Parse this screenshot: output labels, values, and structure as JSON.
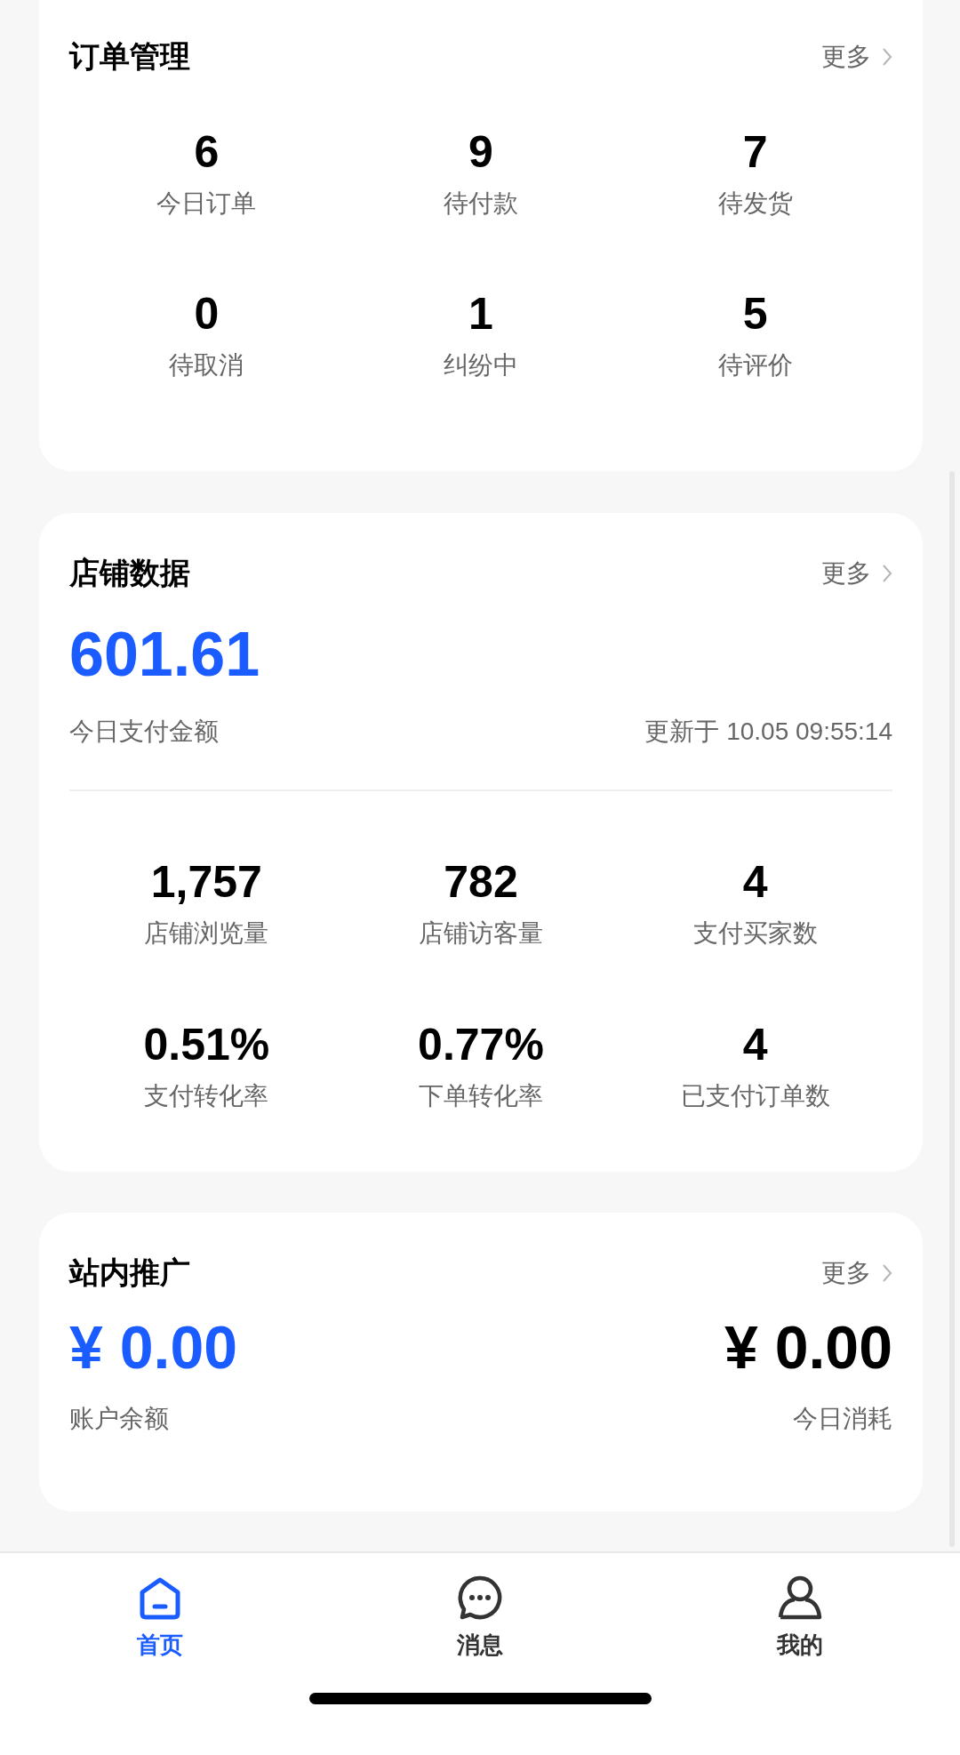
{
  "order_management": {
    "title": "订单管理",
    "more": "更多",
    "stats": [
      {
        "value": "6",
        "label": "今日订单"
      },
      {
        "value": "9",
        "label": "待付款"
      },
      {
        "value": "7",
        "label": "待发货"
      },
      {
        "value": "0",
        "label": "待取消"
      },
      {
        "value": "1",
        "label": "纠纷中"
      },
      {
        "value": "5",
        "label": "待评价"
      }
    ]
  },
  "store_data": {
    "title": "店铺数据",
    "more": "更多",
    "amount": "601.61",
    "amount_label": "今日支付金额",
    "updated": "更新于 10.05 09:55:14",
    "stats": [
      {
        "value": "1,757",
        "label": "店铺浏览量"
      },
      {
        "value": "782",
        "label": "店铺访客量"
      },
      {
        "value": "4",
        "label": "支付买家数"
      },
      {
        "value": "0.51%",
        "label": "支付转化率"
      },
      {
        "value": "0.77%",
        "label": "下单转化率"
      },
      {
        "value": "4",
        "label": "已支付订单数"
      }
    ]
  },
  "promotion": {
    "title": "站内推广",
    "more": "更多",
    "balance": "¥ 0.00",
    "balance_label": "账户余额",
    "spend": "¥ 0.00",
    "spend_label": "今日消耗"
  },
  "tabs": [
    {
      "kind": "home",
      "label": "首页",
      "selected": true
    },
    {
      "kind": "message",
      "label": "消息",
      "selected": false
    },
    {
      "kind": "profile",
      "label": "我的",
      "selected": false
    }
  ]
}
